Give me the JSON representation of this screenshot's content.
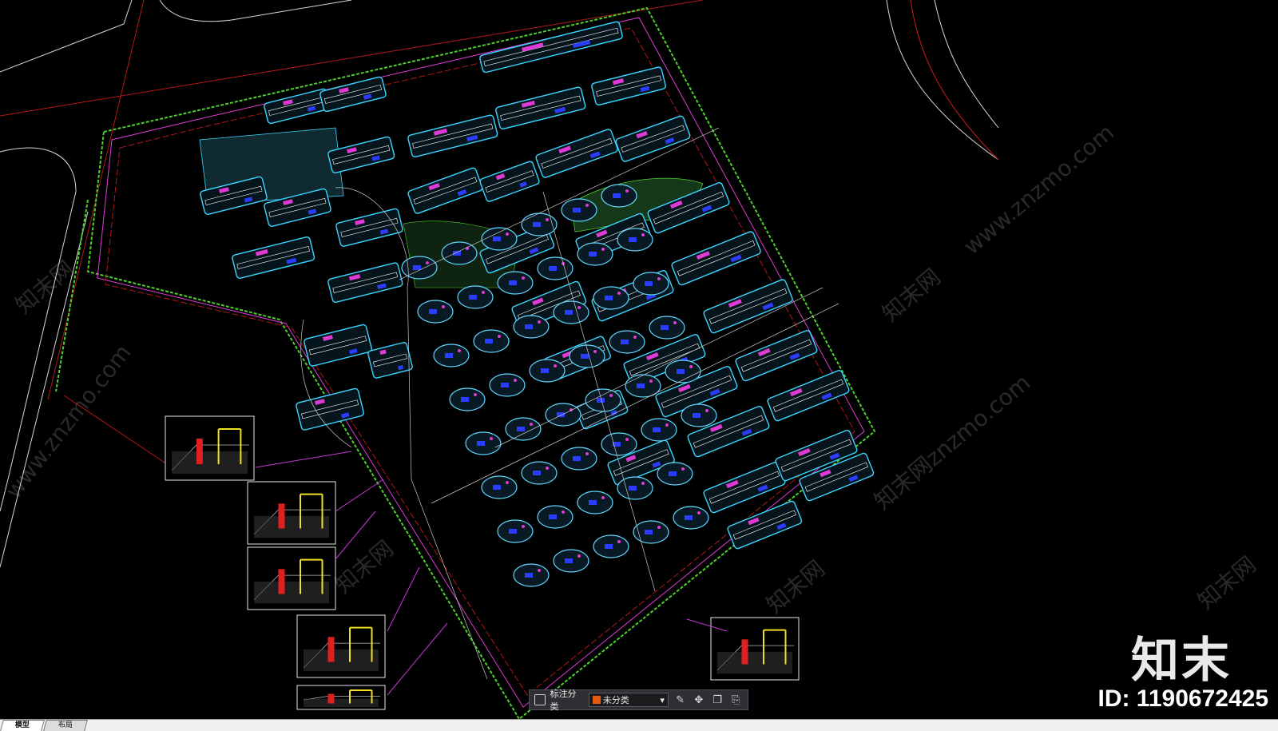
{
  "toolbar": {
    "label": "标注分类",
    "selected": "未分类",
    "swatch_color": "#e85a12"
  },
  "tabs": [
    {
      "label": "模型",
      "active": true
    },
    {
      "label": "布局",
      "active": false
    }
  ],
  "watermark": {
    "logo": "知末",
    "site_cn": "知末网",
    "site_url": "www.znzmo.com",
    "site_partial": "知末网znzmo.com",
    "id_label": "ID: 1190672425"
  },
  "colors": {
    "background": "#000000",
    "boundary_green": "#4ecf2c",
    "road_red": "#b01818",
    "building_cyan": "#3ad6ff",
    "accent_magenta": "#e03ad6",
    "accent_yellow": "#f0e020",
    "accent_blue": "#2a3cff"
  }
}
